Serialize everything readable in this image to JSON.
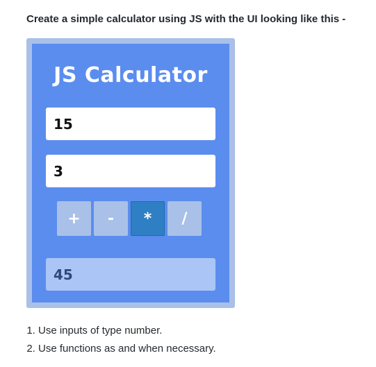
{
  "prompt": "Create a simple calculator using JS with the UI looking like this -",
  "calculator": {
    "title": "JS Calculator",
    "input1": "15",
    "input2": "3",
    "operators": [
      "+",
      "-",
      "*",
      "/"
    ],
    "active_operator": "*",
    "result": "45",
    "colors": {
      "frame": "#a9c0e8",
      "panel": "#5b8def",
      "button": "#a9c0e8",
      "button_active": "#2f7fc4",
      "result_bg": "#abc6f6",
      "result_text": "#2e4a7d"
    }
  },
  "instructions": [
    "Use inputs of type number.",
    "Use functions as and when necessary."
  ]
}
